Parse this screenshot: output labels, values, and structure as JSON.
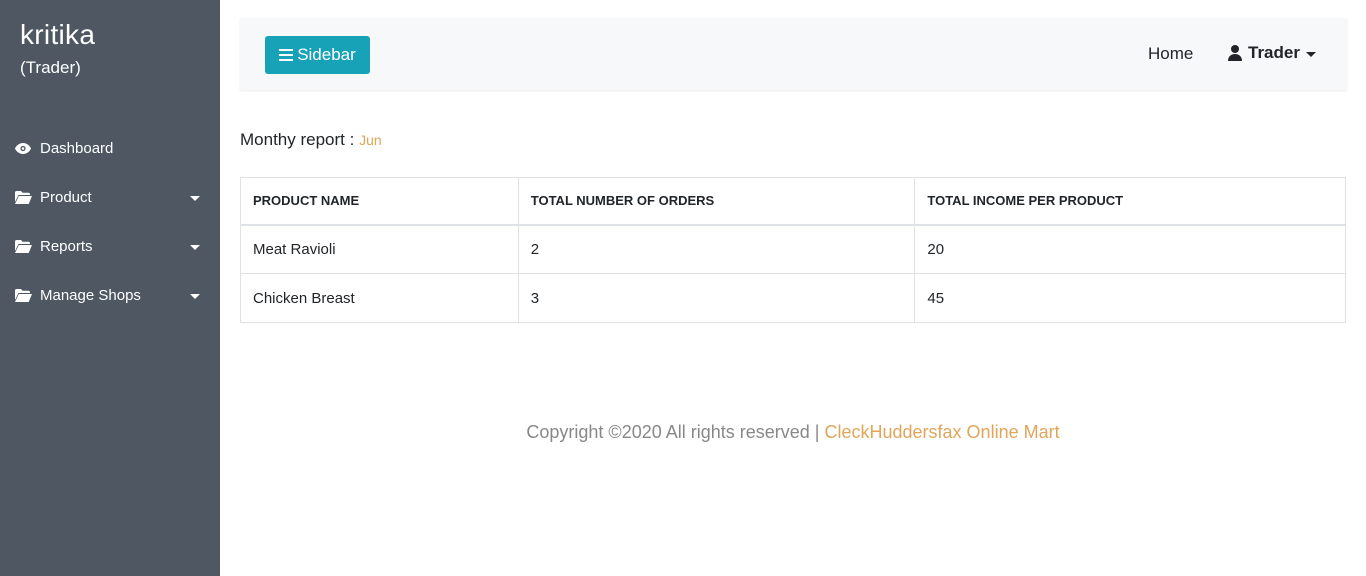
{
  "sidebar": {
    "user_name": "kritika",
    "user_role": "(Trader)",
    "items": [
      {
        "label": "Dashboard",
        "icon": "eye-icon",
        "has_caret": false
      },
      {
        "label": "Product",
        "icon": "folder-icon",
        "has_caret": true
      },
      {
        "label": "Reports",
        "icon": "folder-icon",
        "has_caret": true
      },
      {
        "label": "Manage Shops",
        "icon": "folder-icon",
        "has_caret": true
      }
    ]
  },
  "topbar": {
    "sidebar_button": "Sidebar",
    "home_link": "Home",
    "user_menu": "Trader"
  },
  "report": {
    "title_label": "Monthy report :",
    "month": "Jun"
  },
  "table": {
    "headers": [
      "PRODUCT NAME",
      "TOTAL NUMBER OF ORDERS",
      "TOTAL INCOME PER PRODUCT"
    ],
    "rows": [
      [
        "Meat Ravioli",
        "2",
        "20"
      ],
      [
        "Chicken Breast",
        "3",
        "45"
      ]
    ]
  },
  "footer": {
    "copyright": "Copyright ©2020 All rights reserved |",
    "brand": "CleckHuddersfax Online Mart"
  },
  "colors": {
    "sidebar_bg": "#4e5762",
    "button_accent": "#17a2b8",
    "highlight": "#e0a55a"
  }
}
